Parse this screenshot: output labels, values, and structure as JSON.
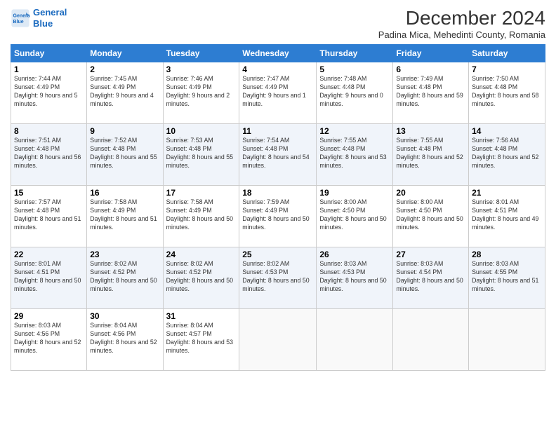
{
  "logo": {
    "line1": "General",
    "line2": "Blue"
  },
  "title": "December 2024",
  "subtitle": "Padina Mica, Mehedinti County, Romania",
  "weekdays": [
    "Sunday",
    "Monday",
    "Tuesday",
    "Wednesday",
    "Thursday",
    "Friday",
    "Saturday"
  ],
  "weeks": [
    [
      {
        "day": "1",
        "rise": "7:44 AM",
        "set": "4:49 PM",
        "daylight": "9 hours and 5 minutes."
      },
      {
        "day": "2",
        "rise": "7:45 AM",
        "set": "4:49 PM",
        "daylight": "9 hours and 4 minutes."
      },
      {
        "day": "3",
        "rise": "7:46 AM",
        "set": "4:49 PM",
        "daylight": "9 hours and 2 minutes."
      },
      {
        "day": "4",
        "rise": "7:47 AM",
        "set": "4:49 PM",
        "daylight": "9 hours and 1 minute."
      },
      {
        "day": "5",
        "rise": "7:48 AM",
        "set": "4:48 PM",
        "daylight": "9 hours and 0 minutes."
      },
      {
        "day": "6",
        "rise": "7:49 AM",
        "set": "4:48 PM",
        "daylight": "8 hours and 59 minutes."
      },
      {
        "day": "7",
        "rise": "7:50 AM",
        "set": "4:48 PM",
        "daylight": "8 hours and 58 minutes."
      }
    ],
    [
      {
        "day": "8",
        "rise": "7:51 AM",
        "set": "4:48 PM",
        "daylight": "8 hours and 56 minutes."
      },
      {
        "day": "9",
        "rise": "7:52 AM",
        "set": "4:48 PM",
        "daylight": "8 hours and 55 minutes."
      },
      {
        "day": "10",
        "rise": "7:53 AM",
        "set": "4:48 PM",
        "daylight": "8 hours and 55 minutes."
      },
      {
        "day": "11",
        "rise": "7:54 AM",
        "set": "4:48 PM",
        "daylight": "8 hours and 54 minutes."
      },
      {
        "day": "12",
        "rise": "7:55 AM",
        "set": "4:48 PM",
        "daylight": "8 hours and 53 minutes."
      },
      {
        "day": "13",
        "rise": "7:55 AM",
        "set": "4:48 PM",
        "daylight": "8 hours and 52 minutes."
      },
      {
        "day": "14",
        "rise": "7:56 AM",
        "set": "4:48 PM",
        "daylight": "8 hours and 52 minutes."
      }
    ],
    [
      {
        "day": "15",
        "rise": "7:57 AM",
        "set": "4:48 PM",
        "daylight": "8 hours and 51 minutes."
      },
      {
        "day": "16",
        "rise": "7:58 AM",
        "set": "4:49 PM",
        "daylight": "8 hours and 51 minutes."
      },
      {
        "day": "17",
        "rise": "7:58 AM",
        "set": "4:49 PM",
        "daylight": "8 hours and 50 minutes."
      },
      {
        "day": "18",
        "rise": "7:59 AM",
        "set": "4:49 PM",
        "daylight": "8 hours and 50 minutes."
      },
      {
        "day": "19",
        "rise": "8:00 AM",
        "set": "4:50 PM",
        "daylight": "8 hours and 50 minutes."
      },
      {
        "day": "20",
        "rise": "8:00 AM",
        "set": "4:50 PM",
        "daylight": "8 hours and 50 minutes."
      },
      {
        "day": "21",
        "rise": "8:01 AM",
        "set": "4:51 PM",
        "daylight": "8 hours and 49 minutes."
      }
    ],
    [
      {
        "day": "22",
        "rise": "8:01 AM",
        "set": "4:51 PM",
        "daylight": "8 hours and 50 minutes."
      },
      {
        "day": "23",
        "rise": "8:02 AM",
        "set": "4:52 PM",
        "daylight": "8 hours and 50 minutes."
      },
      {
        "day": "24",
        "rise": "8:02 AM",
        "set": "4:52 PM",
        "daylight": "8 hours and 50 minutes."
      },
      {
        "day": "25",
        "rise": "8:02 AM",
        "set": "4:53 PM",
        "daylight": "8 hours and 50 minutes."
      },
      {
        "day": "26",
        "rise": "8:03 AM",
        "set": "4:53 PM",
        "daylight": "8 hours and 50 minutes."
      },
      {
        "day": "27",
        "rise": "8:03 AM",
        "set": "4:54 PM",
        "daylight": "8 hours and 50 minutes."
      },
      {
        "day": "28",
        "rise": "8:03 AM",
        "set": "4:55 PM",
        "daylight": "8 hours and 51 minutes."
      }
    ],
    [
      {
        "day": "29",
        "rise": "8:03 AM",
        "set": "4:56 PM",
        "daylight": "8 hours and 52 minutes."
      },
      {
        "day": "30",
        "rise": "8:04 AM",
        "set": "4:56 PM",
        "daylight": "8 hours and 52 minutes."
      },
      {
        "day": "31",
        "rise": "8:04 AM",
        "set": "4:57 PM",
        "daylight": "8 hours and 53 minutes."
      },
      null,
      null,
      null,
      null
    ]
  ]
}
